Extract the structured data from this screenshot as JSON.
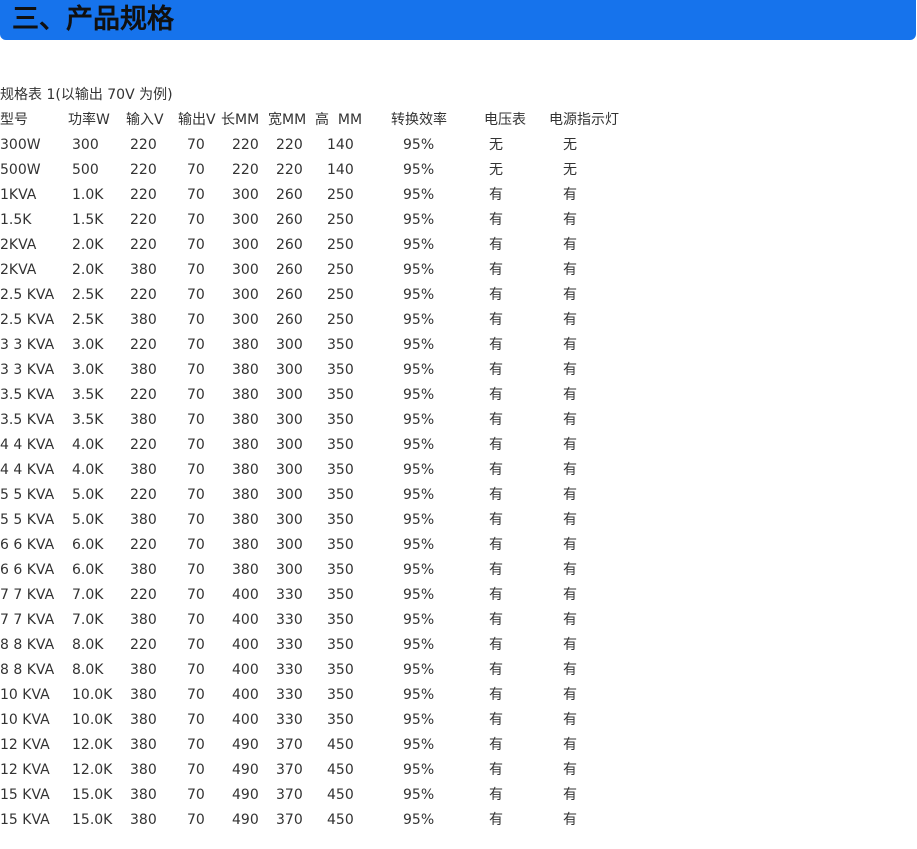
{
  "header": {
    "title": "三、产品规格",
    "accent_color": "#1673ec"
  },
  "caption": "规格表 1(以输出 70V 为例)",
  "table": {
    "headers": [
      "型号",
      "功率W",
      "输入V",
      "输出V",
      "长MM",
      "宽MM",
      "高  MM",
      "转换效率",
      "电压表",
      "电源指示灯"
    ],
    "rows": [
      [
        "300W",
        "300",
        "220",
        "70",
        "220",
        "220",
        "140",
        "95%",
        "无",
        "无"
      ],
      [
        "500W",
        "500",
        "220",
        "70",
        "220",
        "220",
        "140",
        "95%",
        "无",
        "无"
      ],
      [
        "1KVA",
        "1.0K",
        "220",
        "70",
        "300",
        "260",
        "250",
        "95%",
        "有",
        "有"
      ],
      [
        "1.5K",
        "1.5K",
        "220",
        "70",
        "300",
        "260",
        "250",
        "95%",
        "有",
        "有"
      ],
      [
        "2KVA",
        "2.0K",
        "220",
        "70",
        "300",
        "260",
        "250",
        "95%",
        "有",
        "有"
      ],
      [
        "2KVA",
        "2.0K",
        "380",
        "70",
        "300",
        "260",
        "250",
        "95%",
        "有",
        "有"
      ],
      [
        "2.5 KVA",
        "2.5K",
        "220",
        "70",
        "300",
        "260",
        "250",
        "95%",
        "有",
        "有"
      ],
      [
        "2.5 KVA",
        "2.5K",
        "380",
        "70",
        "300",
        "260",
        "250",
        "95%",
        "有",
        "有"
      ],
      [
        "3 3 KVA",
        "3.0K",
        "220",
        "70",
        "380",
        "300",
        "350",
        "95%",
        "有",
        "有"
      ],
      [
        "3 3 KVA",
        "3.0K",
        "380",
        "70",
        "380",
        "300",
        "350",
        "95%",
        "有",
        "有"
      ],
      [
        "3.5 KVA",
        "3.5K",
        "220",
        "70",
        "380",
        "300",
        "350",
        "95%",
        "有",
        "有"
      ],
      [
        "3.5 KVA",
        "3.5K",
        "380",
        "70",
        "380",
        "300",
        "350",
        "95%",
        "有",
        "有"
      ],
      [
        "4 4 KVA",
        "4.0K",
        "220",
        "70",
        "380",
        "300",
        "350",
        "95%",
        "有",
        "有"
      ],
      [
        "4 4 KVA",
        "4.0K",
        "380",
        "70",
        "380",
        "300",
        "350",
        "95%",
        "有",
        "有"
      ],
      [
        "5 5 KVA",
        "5.0K",
        "220",
        "70",
        "380",
        "300",
        "350",
        "95%",
        "有",
        "有"
      ],
      [
        "5 5 KVA",
        "5.0K",
        "380",
        "70",
        "380",
        "300",
        "350",
        "95%",
        "有",
        "有"
      ],
      [
        "6 6 KVA",
        "6.0K",
        "220",
        "70",
        "380",
        "300",
        "350",
        "95%",
        "有",
        "有"
      ],
      [
        "6 6 KVA",
        "6.0K",
        "380",
        "70",
        "380",
        "300",
        "350",
        "95%",
        "有",
        "有"
      ],
      [
        "7 7 KVA",
        "7.0K",
        "220",
        "70",
        "400",
        "330",
        "350",
        "95%",
        "有",
        "有"
      ],
      [
        "7 7 KVA",
        "7.0K",
        "380",
        "70",
        "400",
        "330",
        "350",
        "95%",
        "有",
        "有"
      ],
      [
        "8 8 KVA",
        "8.0K",
        "220",
        "70",
        "400",
        "330",
        "350",
        "95%",
        "有",
        "有"
      ],
      [
        "8 8 KVA",
        "8.0K",
        "380",
        "70",
        "400",
        "330",
        "350",
        "95%",
        "有",
        "有"
      ],
      [
        "10 KVA",
        "10.0K",
        "380",
        "70",
        "400",
        "330",
        "350",
        "95%",
        "有",
        "有"
      ],
      [
        "10 KVA",
        "10.0K",
        "380",
        "70",
        "400",
        "330",
        "350",
        "95%",
        "有",
        "有"
      ],
      [
        "12 KVA",
        "12.0K",
        "380",
        "70",
        "490",
        "370",
        "450",
        "95%",
        "有",
        "有"
      ],
      [
        "12 KVA",
        "12.0K",
        "380",
        "70",
        "490",
        "370",
        "450",
        "95%",
        "有",
        "有"
      ],
      [
        "15 KVA",
        "15.0K",
        "380",
        "70",
        "490",
        "370",
        "450",
        "95%",
        "有",
        "有"
      ],
      [
        "15 KVA",
        "15.0K",
        "380",
        "70",
        "490",
        "370",
        "450",
        "95%",
        "有",
        "有"
      ]
    ]
  }
}
